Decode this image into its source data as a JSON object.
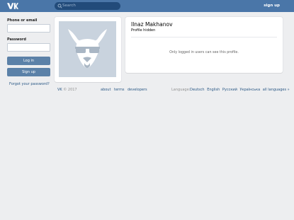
{
  "header": {
    "search_placeholder": "Search",
    "signup_label": "sign up",
    "accent_color": "#4a76a8"
  },
  "login": {
    "phone_label": "Phone or email",
    "password_label": "Password",
    "login_button": "Log in",
    "signup_button": "Sign up",
    "forgot_link": "Forgot your password?"
  },
  "profile": {
    "name": "Ilnaz Makhanov",
    "status": "Profile hidden",
    "message": "Only logged in users can see this profile."
  },
  "footer": {
    "brand": "VK",
    "copyright": "© 2017",
    "links": [
      "about",
      "terms",
      "developers"
    ],
    "language_label": "Language:",
    "languages": [
      "Deutsch",
      "English",
      "Русский",
      "Українська",
      "all languages »"
    ]
  }
}
